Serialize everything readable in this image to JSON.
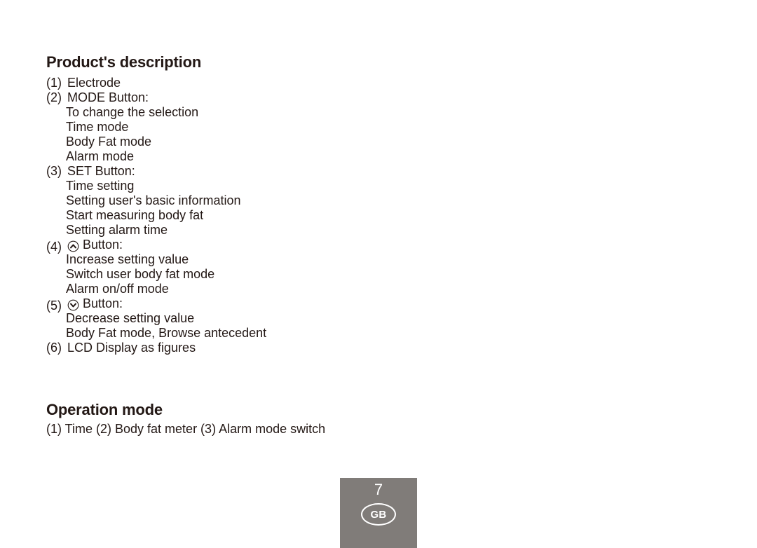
{
  "document": {
    "sections": {
      "product_description": {
        "heading": "Product's description",
        "items": [
          {
            "marker": "(1)",
            "label": "Electrode",
            "icon": null,
            "subitems": []
          },
          {
            "marker": "(2)",
            "label": "MODE Button:",
            "icon": null,
            "subitems": [
              "To change the selection",
              "Time mode",
              "Body Fat mode",
              "Alarm mode"
            ]
          },
          {
            "marker": "(3)",
            "label": "SET Button:",
            "icon": null,
            "subitems": [
              "Time setting",
              "Setting user's basic information",
              "Start measuring body fat",
              "Setting alarm time"
            ]
          },
          {
            "marker": "(4)",
            "label": "Button:",
            "icon": "circled-chevron-up-icon",
            "subitems": [
              "Increase setting value",
              "Switch user body fat mode",
              "Alarm on/off mode"
            ]
          },
          {
            "marker": "(5)",
            "label": "Button:",
            "icon": "circled-chevron-down-icon",
            "subitems": [
              "Decrease setting value",
              "Body Fat mode, Browse antecedent"
            ]
          },
          {
            "marker": "(6)",
            "label": "LCD Display as figures",
            "icon": null,
            "subitems": []
          }
        ]
      },
      "operation_mode": {
        "heading": "Operation mode",
        "line": "(1) Time (2) Body fat meter (3) Alarm mode switch"
      }
    },
    "footer": {
      "page_number": "7",
      "region_code": "GB",
      "background_color": "#807c79",
      "text_color": "#ffffff"
    },
    "colors": {
      "text": "#231815",
      "page_background": "#ffffff"
    }
  }
}
